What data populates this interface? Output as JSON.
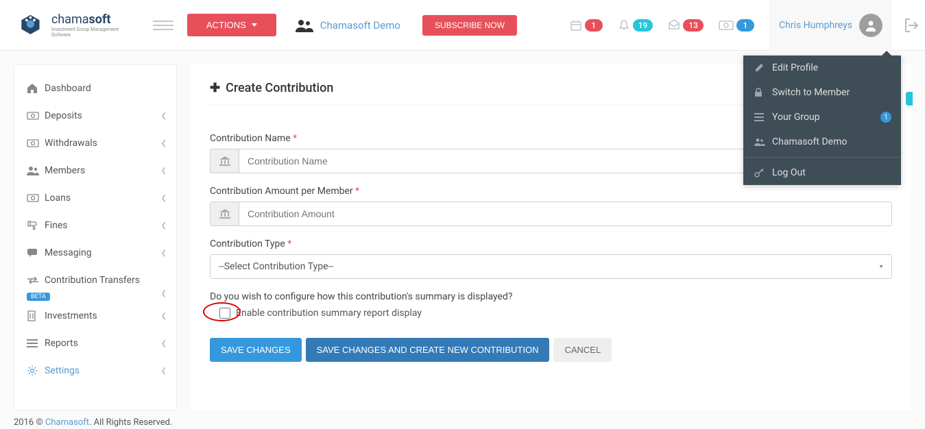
{
  "brand": {
    "part1": "chama",
    "part2": "soft",
    "tagline": "Investment Group Management Software"
  },
  "topbar": {
    "actions_label": "ACTIONS",
    "group_name": "Chamasoft Demo",
    "subscribe_label": "SUBSCRIBE NOW",
    "badge_calendar": "1",
    "badge_bell": "19",
    "badge_mail": "13",
    "badge_money": "1"
  },
  "user": {
    "name": "Chris Humphreys"
  },
  "dropdown": {
    "edit_profile": "Edit Profile",
    "switch_member": "Switch to Member",
    "your_group": "Your Group",
    "your_group_badge": "1",
    "group_demo": "Chamasoft Demo",
    "log_out": "Log Out"
  },
  "sidebar": {
    "items": [
      {
        "label": "Dashboard",
        "icon": "home",
        "expandable": false
      },
      {
        "label": "Deposits",
        "icon": "money",
        "expandable": true
      },
      {
        "label": "Withdrawals",
        "icon": "money",
        "expandable": true
      },
      {
        "label": "Members",
        "icon": "users",
        "expandable": true
      },
      {
        "label": "Loans",
        "icon": "money",
        "expandable": true
      },
      {
        "label": "Fines",
        "icon": "thumbs-down",
        "expandable": true
      },
      {
        "label": "Messaging",
        "icon": "chat",
        "expandable": true
      },
      {
        "label": "Contribution Transfers",
        "icon": "transfer",
        "expandable": true,
        "beta": true
      },
      {
        "label": "Investments",
        "icon": "building",
        "expandable": true
      },
      {
        "label": "Reports",
        "icon": "lines",
        "expandable": true
      },
      {
        "label": "Settings",
        "icon": "gear",
        "expandable": true,
        "active": true
      }
    ],
    "beta_label": "BETA"
  },
  "page": {
    "title": "Create Contribution",
    "fields": {
      "name": {
        "label": "Contribution Name",
        "placeholder": "Contribution Name"
      },
      "amount": {
        "label": "Contribution Amount per Member",
        "placeholder": "Contribution Amount"
      },
      "type": {
        "label": "Contribution Type",
        "value": "--Select Contribution Type--"
      }
    },
    "question": "Do you wish to configure how this contribution's summary is displayed?",
    "checkbox_label": "Enable contribution summary report display",
    "buttons": {
      "save": "SAVE CHANGES",
      "save_new": "SAVE CHANGES AND CREATE NEW CONTRIBUTION",
      "cancel": "CANCEL"
    }
  },
  "footer": {
    "year": "2016 ©",
    "name": "Chamasoft",
    "rights": ". All Rights Reserved."
  }
}
